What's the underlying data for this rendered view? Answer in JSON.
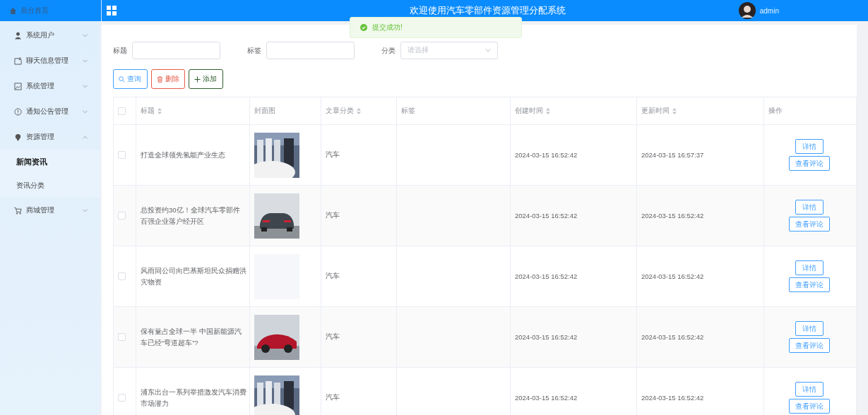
{
  "header": {
    "home": "后台首页",
    "title": "欢迎使用汽车零部件资源管理分配系统",
    "user": "admin"
  },
  "toast": {
    "kind": "success",
    "text": "提交成功!"
  },
  "sidebar": {
    "items": [
      {
        "label": "系统用户",
        "expanded": false
      },
      {
        "label": "聊天信息管理",
        "expanded": false
      },
      {
        "label": "系统管理",
        "expanded": false
      },
      {
        "label": "通知公告管理",
        "expanded": false
      },
      {
        "label": "资源管理",
        "expanded": true,
        "children": [
          {
            "label": "新闻资讯",
            "selected": true
          },
          {
            "label": "资讯分类",
            "selected": false
          }
        ]
      },
      {
        "label": "商城管理",
        "expanded": false
      }
    ]
  },
  "filters": [
    {
      "label": "标题",
      "kind": "input"
    },
    {
      "label": "标签",
      "kind": "input"
    },
    {
      "label": "分类",
      "kind": "select",
      "placeholder": "请选择"
    }
  ],
  "actions": [
    {
      "label": "查询",
      "kind": "search"
    },
    {
      "label": "删除",
      "kind": "delete"
    },
    {
      "label": "添加",
      "kind": "add"
    }
  ],
  "table": {
    "columns": [
      {
        "label": "标题",
        "sortable": true
      },
      {
        "label": "封面图",
        "sortable": false
      },
      {
        "label": "文章分类",
        "sortable": true
      },
      {
        "label": "标签",
        "sortable": false
      },
      {
        "label": "创建时间",
        "sortable": true
      },
      {
        "label": "更新时间",
        "sortable": true
      },
      {
        "label": "操作",
        "sortable": false
      }
    ],
    "header_checked": false,
    "rows": [
      {
        "checked": false,
        "title": "打造全球领先氢能产业生态",
        "cover": {
          "kind": "picture"
        },
        "category": "汽车",
        "created": "2024-03-15 16:52:42",
        "updated": "2024-03-15 16:57:37",
        "buttons": [
          "详情",
          "查看评论"
        ]
      },
      {
        "checked": false,
        "title": "总投资约30亿！全球汽车零部件百强企业落户经开区",
        "cover": {
          "kind": "picture"
        },
        "category": "汽车",
        "created": "2024-03-15 16:52:42",
        "updated": "2024-03-15 16:52:42",
        "buttons": [
          "详情",
          "查看评论"
        ]
      },
      {
        "checked": false,
        "title": "风雨同公司向巴基斯坦民众捐赠洪灾物资",
        "cover": {
          "kind": "placeholder"
        },
        "category": "汽车",
        "created": "2024-03-15 16:52:42",
        "updated": "2024-03-15 16:52:42",
        "buttons": [
          "详情",
          "查看评论"
        ]
      },
      {
        "checked": false,
        "title": "保有量占全球一半 中国新能源汽车已经“弯道超车”?",
        "cover": {
          "kind": "picture"
        },
        "category": "汽车",
        "created": "2024-03-15 16:52:42",
        "updated": "2024-03-15 16:52:42",
        "buttons": [
          "详情",
          "查看评论"
        ]
      },
      {
        "checked": false,
        "title": "浦东出台一系列举措激发汽车消费市场潜力",
        "cover": {
          "kind": "picture"
        },
        "category": "汽车",
        "created": "2024-03-15 16:52:42",
        "updated": "2024-03-15 16:52:42",
        "buttons": [
          "详情",
          "查看评论"
        ]
      }
    ]
  }
}
